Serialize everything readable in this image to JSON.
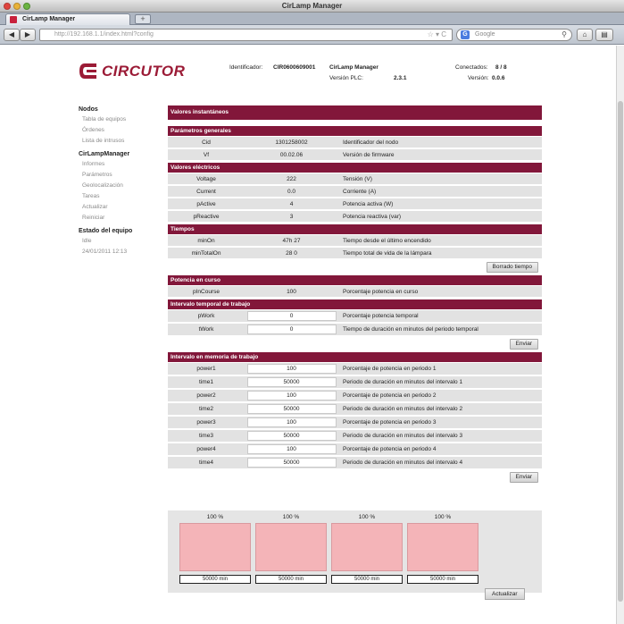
{
  "window": {
    "title": "CirLamp Manager"
  },
  "tab": {
    "label": "CirLamp Manager",
    "new_tab": "+"
  },
  "nav": {
    "back": "◀",
    "forward": "▶",
    "url": "http://192.168.1.1/index.html?config",
    "url_icons": "☆ ▾ C",
    "search_placeholder": "Google",
    "home": "⌂",
    "menu": "▤"
  },
  "brand": {
    "name": "CIRCUTOR"
  },
  "header": {
    "id_label": "Identificador:",
    "id_value": "CIR0600609001",
    "app_name": "CirLamp Manager",
    "plc_label": "Versión PLC:",
    "plc_value": "2.3.1",
    "connected_label": "Conectados:",
    "connected_value": "8 / 8",
    "version_label": "Versión:",
    "version_value": "0.0.6"
  },
  "sidebar": {
    "nodes_head": "Nodos",
    "nodes_items": [
      "Tabla de equipos",
      "Órdenes",
      "Lista de intrusos"
    ],
    "manager_head": "CirLampManager",
    "manager_items": [
      "Informes",
      "Parámetros",
      "Geolocalización",
      "Tareas",
      "Actualizar",
      "Reiniciar"
    ],
    "status_head": "Estado del equipo",
    "status_value": "Idle",
    "status_time": "24/01/2011 12:13"
  },
  "main": {
    "title": "Valores instantáneos",
    "general_head": "Parámetros generales",
    "general_rows": [
      {
        "name": "Cid",
        "value": "1301258002",
        "desc": "Identificador del nodo"
      },
      {
        "name": "Vf",
        "value": "00.02.06",
        "desc": "Versión de firmware"
      }
    ],
    "electric_head": "Valores eléctricos",
    "electric_rows": [
      {
        "name": "Voltage",
        "value": "222",
        "desc": "Tensión (V)"
      },
      {
        "name": "Current",
        "value": "0.0",
        "desc": "Corriente (A)"
      },
      {
        "name": "pActive",
        "value": "4",
        "desc": "Potencia activa (W)"
      },
      {
        "name": "pReactive",
        "value": "3",
        "desc": "Potencia reactiva (var)"
      }
    ],
    "times_head": "Tiempos",
    "times_rows": [
      {
        "name": "minOn",
        "value": "47h 27",
        "desc": "Tiempo desde el último encendido"
      },
      {
        "name": "minTotalOn",
        "value": "28 0",
        "desc": "Tiempo total de vida de la lámpara"
      }
    ],
    "clear_times_btn": "Borrado tiempo",
    "power_head": "Potencia en curso",
    "power_rows": [
      {
        "name": "pInCourse",
        "value": "100",
        "desc": "Porcentaje potencia en curso"
      }
    ],
    "temporal_head": "Intervalo temporal de trabajo",
    "temporal_rows": [
      {
        "name": "pWork",
        "value": "0",
        "desc": "Porcentaje potencia temporal"
      },
      {
        "name": "tWork",
        "value": "0",
        "desc": "Tiempo de duración en minutos del periodo temporal"
      }
    ],
    "send_btn_1": "Enviar",
    "memory_head": "Intervalo en memoria de trabajo",
    "memory_rows": [
      {
        "name": "power1",
        "value": "100",
        "desc": "Porcentaje de potencia en periodo 1"
      },
      {
        "name": "time1",
        "value": "50000",
        "desc": "Periodo de duración en minutos del intervalo 1"
      },
      {
        "name": "power2",
        "value": "100",
        "desc": "Porcentaje de potencia en periodo 2"
      },
      {
        "name": "time2",
        "value": "50000",
        "desc": "Periodo de duración en minutos del intervalo 2"
      },
      {
        "name": "power3",
        "value": "100",
        "desc": "Porcentaje de potencia en periodo 3"
      },
      {
        "name": "time3",
        "value": "50000",
        "desc": "Periodo de duración en minutos del intervalo 3"
      },
      {
        "name": "power4",
        "value": "100",
        "desc": "Porcentaje de potencia en periodo 4"
      },
      {
        "name": "time4",
        "value": "50000",
        "desc": "Periodo de duración en minutos del intervalo 4"
      }
    ],
    "send_btn_2": "Enviar",
    "bars": [
      {
        "pct": "100 %",
        "minutes": "50000 min"
      },
      {
        "pct": "100 %",
        "minutes": "50000 min"
      },
      {
        "pct": "100 %",
        "minutes": "50000 min"
      },
      {
        "pct": "100 %",
        "minutes": "50000 min"
      }
    ],
    "update_btn": "Actualizar"
  },
  "colors": {
    "accent": "#82173a",
    "row_bg": "#e2e2e2",
    "bar_fill": "#f4b4b8"
  }
}
